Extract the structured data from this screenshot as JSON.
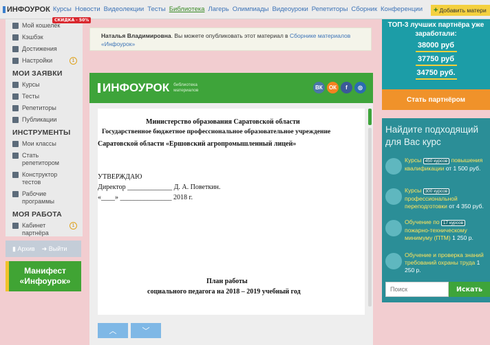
{
  "topnav": {
    "logo": "ИНФОУРОК",
    "discount_badge": "СКИДКА - 50%",
    "links": [
      "Курсы",
      "Новости",
      "Видеолекции",
      "Тесты",
      "Библиотека",
      "Лагерь",
      "Олимпиады",
      "Видеоуроки",
      "Репетиторы",
      "Сборник",
      "Конференции"
    ],
    "active_link": "Библиотека",
    "add_material": "Добавить матери"
  },
  "sidebar": {
    "top_items": [
      {
        "label": "Мой кошелёк",
        "icon": "wallet-icon"
      },
      {
        "label": "Кэшбэк",
        "icon": "cashback-icon"
      },
      {
        "label": "Достижения",
        "icon": "trophy-icon"
      },
      {
        "label": "Настройки",
        "icon": "gear-icon",
        "count": "1"
      }
    ],
    "section_requests": "МОИ ЗАЯВКИ",
    "request_items": [
      {
        "label": "Курсы"
      },
      {
        "label": "Тесты"
      },
      {
        "label": "Репетиторы"
      },
      {
        "label": "Публикации"
      }
    ],
    "section_tools": "ИНСТРУМЕНТЫ",
    "tool_items": [
      {
        "label": "Мои классы"
      },
      {
        "label": "Стать репетитором"
      },
      {
        "label": "Конструктор тестов"
      },
      {
        "label": "Рабочие программы"
      }
    ],
    "section_work": "МОЯ РАБОТА",
    "work_items": [
      {
        "label": "Кабинет партнёра",
        "count": "1"
      }
    ],
    "archive": "Архив",
    "logout": "Выйти",
    "manifest_line1": "Манифест",
    "manifest_line2": "«Инфоурок»"
  },
  "notice": {
    "name": "Наталья Владимировна",
    "text": ". Вы можете опубликовать этот материал в ",
    "link": "Сборнике материалов «Инфоурок»"
  },
  "viewer": {
    "logo": "ИНФОУРОК",
    "logo_sub": "библиотека материалов",
    "social": [
      "ВК",
      "ОК",
      "f",
      "◎"
    ],
    "doc": {
      "line1": "Министерство образования Саратовской области",
      "line2": "Государственное бюджетное профессиональное образовательное учреждение",
      "line3": "Саратовской области «Ершовский агропромышленный лицей»",
      "approve": "УТВЕРЖДАЮ",
      "director": "Директор _____________ Д. А. Поветкин.",
      "date": "«____» _______________ 2018 г.",
      "plan_title": "План работы",
      "plan_sub": "социального педагога на 2018 – 2019 учебный год"
    }
  },
  "partners": {
    "title": "ТОП-3 лучших партнёра уже заработали:",
    "amounts": [
      "38000 руб",
      "37750 руб",
      "34750 руб."
    ],
    "button": "Стать партнёром"
  },
  "courses": {
    "heading": "Найдите подходящий для Вас курс",
    "items": [
      {
        "pre": "Курсы ",
        "tag": "450 курсов",
        "hl": "повышения квалификации",
        "price": " от 1 500 руб."
      },
      {
        "pre": "Курсы ",
        "tag": "300 курсов",
        "hl": "профессиональной переподготовки",
        "price": " от 4 350 руб."
      },
      {
        "pre": "Обучение по ",
        "tag": "17 курсов",
        "hl": "пожарно-техническому минимуму (ПТМ)",
        "price": " 1 250 р."
      },
      {
        "pre": "",
        "tag": "",
        "hl": "Обучение и проверка знаний требований охраны труда",
        "price": " 1 250 р."
      }
    ],
    "search_placeholder": "Поиск",
    "search_button": "Искать"
  }
}
